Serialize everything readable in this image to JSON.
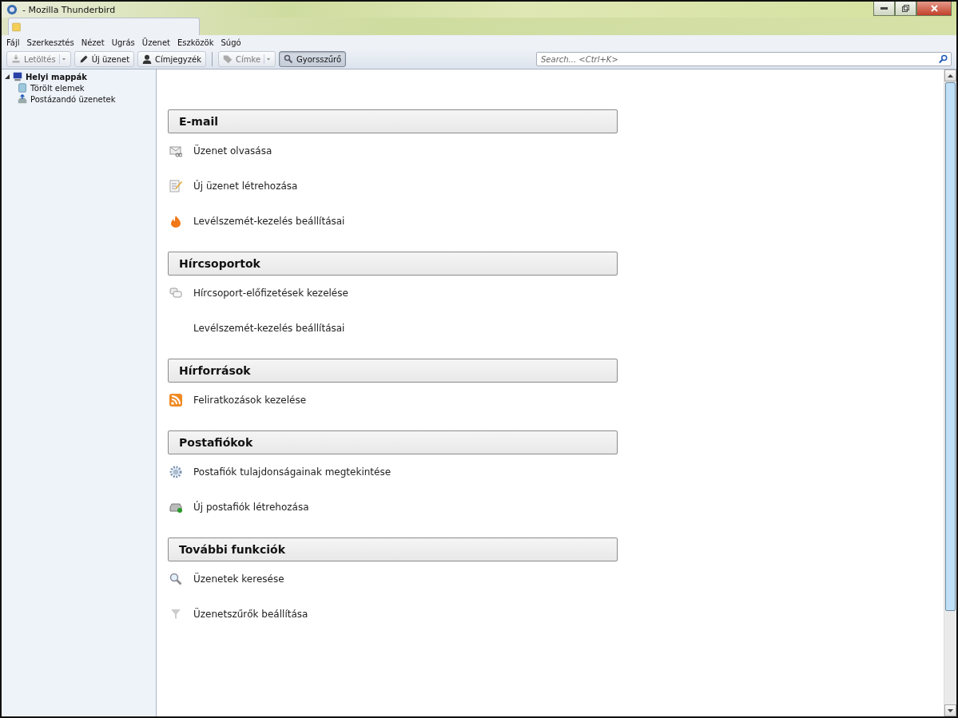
{
  "window": {
    "title": "- Mozilla Thunderbird"
  },
  "menu": [
    "Fájl",
    "Szerkesztés",
    "Nézet",
    "Ugrás",
    "Üzenet",
    "Eszközök",
    "Súgó"
  ],
  "toolbar": [
    {
      "kind": "download",
      "label": "Letöltés",
      "disabled": true,
      "dropdown": true,
      "selected": false
    },
    {
      "kind": "write",
      "label": "Új üzenet",
      "disabled": false,
      "dropdown": false,
      "selected": false
    },
    {
      "kind": "contacts",
      "label": "Címjegyzék",
      "disabled": false,
      "dropdown": false,
      "selected": false
    },
    {
      "kind": "tag",
      "label": "Címke",
      "disabled": true,
      "dropdown": true,
      "selected": false
    },
    {
      "kind": "filter",
      "label": "Gyorsszűrő",
      "disabled": false,
      "dropdown": false,
      "selected": true
    }
  ],
  "search": {
    "placeholder": "Search... <Ctrl+K>"
  },
  "sidebar": {
    "items": [
      {
        "label": "Helyi mappák",
        "kind": "computer",
        "expanded": true,
        "children": [
          {
            "label": "Törölt elemek",
            "kind": "trash"
          },
          {
            "label": "Postázandó üzenetek",
            "kind": "outbox"
          }
        ]
      }
    ]
  },
  "sections": [
    {
      "title": "E-mail",
      "items": [
        {
          "kind": "read",
          "label": "Üzenet olvasása"
        },
        {
          "kind": "compose",
          "label": "Új üzenet létrehozása"
        },
        {
          "kind": "junk",
          "label": "Levélszemét-kezelés beállításai"
        }
      ]
    },
    {
      "title": "Hírcsoportok",
      "items": [
        {
          "kind": "newsgroup",
          "label": "Hírcsoport-előfizetések kezelése"
        },
        {
          "kind": "none",
          "label": "Levélszemét-kezelés beállításai"
        }
      ]
    },
    {
      "title": "Hírforrások",
      "items": [
        {
          "kind": "rss",
          "label": "Feliratkozások kezelése"
        }
      ]
    },
    {
      "title": "Postafiókok",
      "items": [
        {
          "kind": "settings",
          "label": "Postafiók tulajdonságainak megtekintése"
        },
        {
          "kind": "new-account",
          "label": "Új postafiók létrehozása"
        }
      ]
    },
    {
      "title": "További funkciók",
      "items": [
        {
          "kind": "search",
          "label": "Üzenetek keresése"
        },
        {
          "kind": "filters",
          "label": "Üzenetszűrők beállítása"
        }
      ]
    }
  ]
}
